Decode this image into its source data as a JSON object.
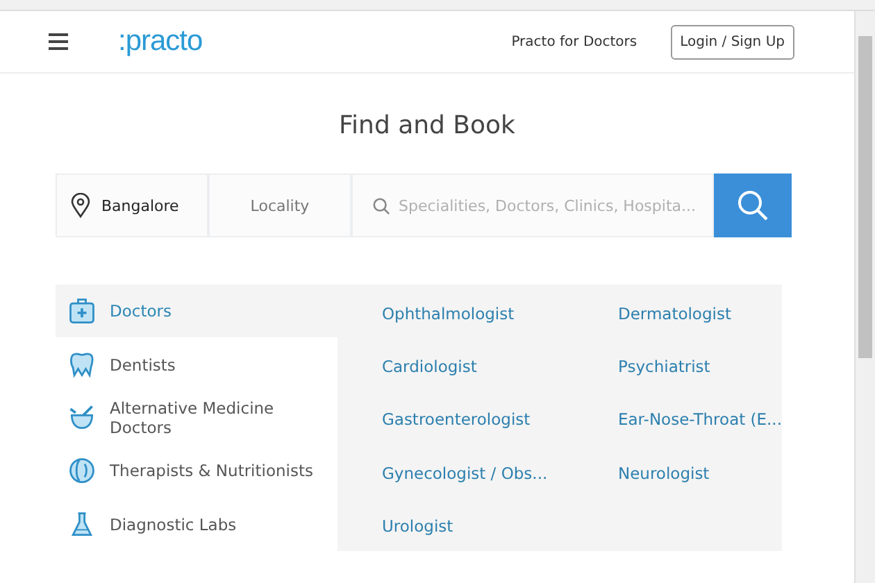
{
  "header": {
    "logo": ":practo",
    "links": [
      {
        "label": "Practo for Doctors",
        "kind": "link"
      },
      {
        "label": "Login / Sign Up",
        "kind": "button"
      }
    ]
  },
  "title": "Find and Book",
  "search": {
    "city": "Bangalore",
    "locality_placeholder": "Locality",
    "query_placeholder": "Specialities, Doctors, Clinics, Hospita..."
  },
  "categories": [
    {
      "label": "Doctors",
      "kind": "doctors",
      "selected": true
    },
    {
      "label": "Dentists",
      "kind": "dentists",
      "selected": false
    },
    {
      "label": "Alternative Medicine Doctors",
      "kind": "alternative",
      "selected": false
    },
    {
      "label": "Therapists & Nutritionists",
      "kind": "therapists",
      "selected": false
    },
    {
      "label": "Diagnostic Labs",
      "kind": "labs",
      "selected": false
    }
  ],
  "specialities": [
    "Ophthalmologist",
    "Dermatologist",
    "Cardiologist",
    "Psychiatrist",
    "Gastroenterologist",
    "Ear-Nose-Throat (E...",
    "Gynecologist / Obs...",
    "Neurologist",
    "Urologist"
  ]
}
